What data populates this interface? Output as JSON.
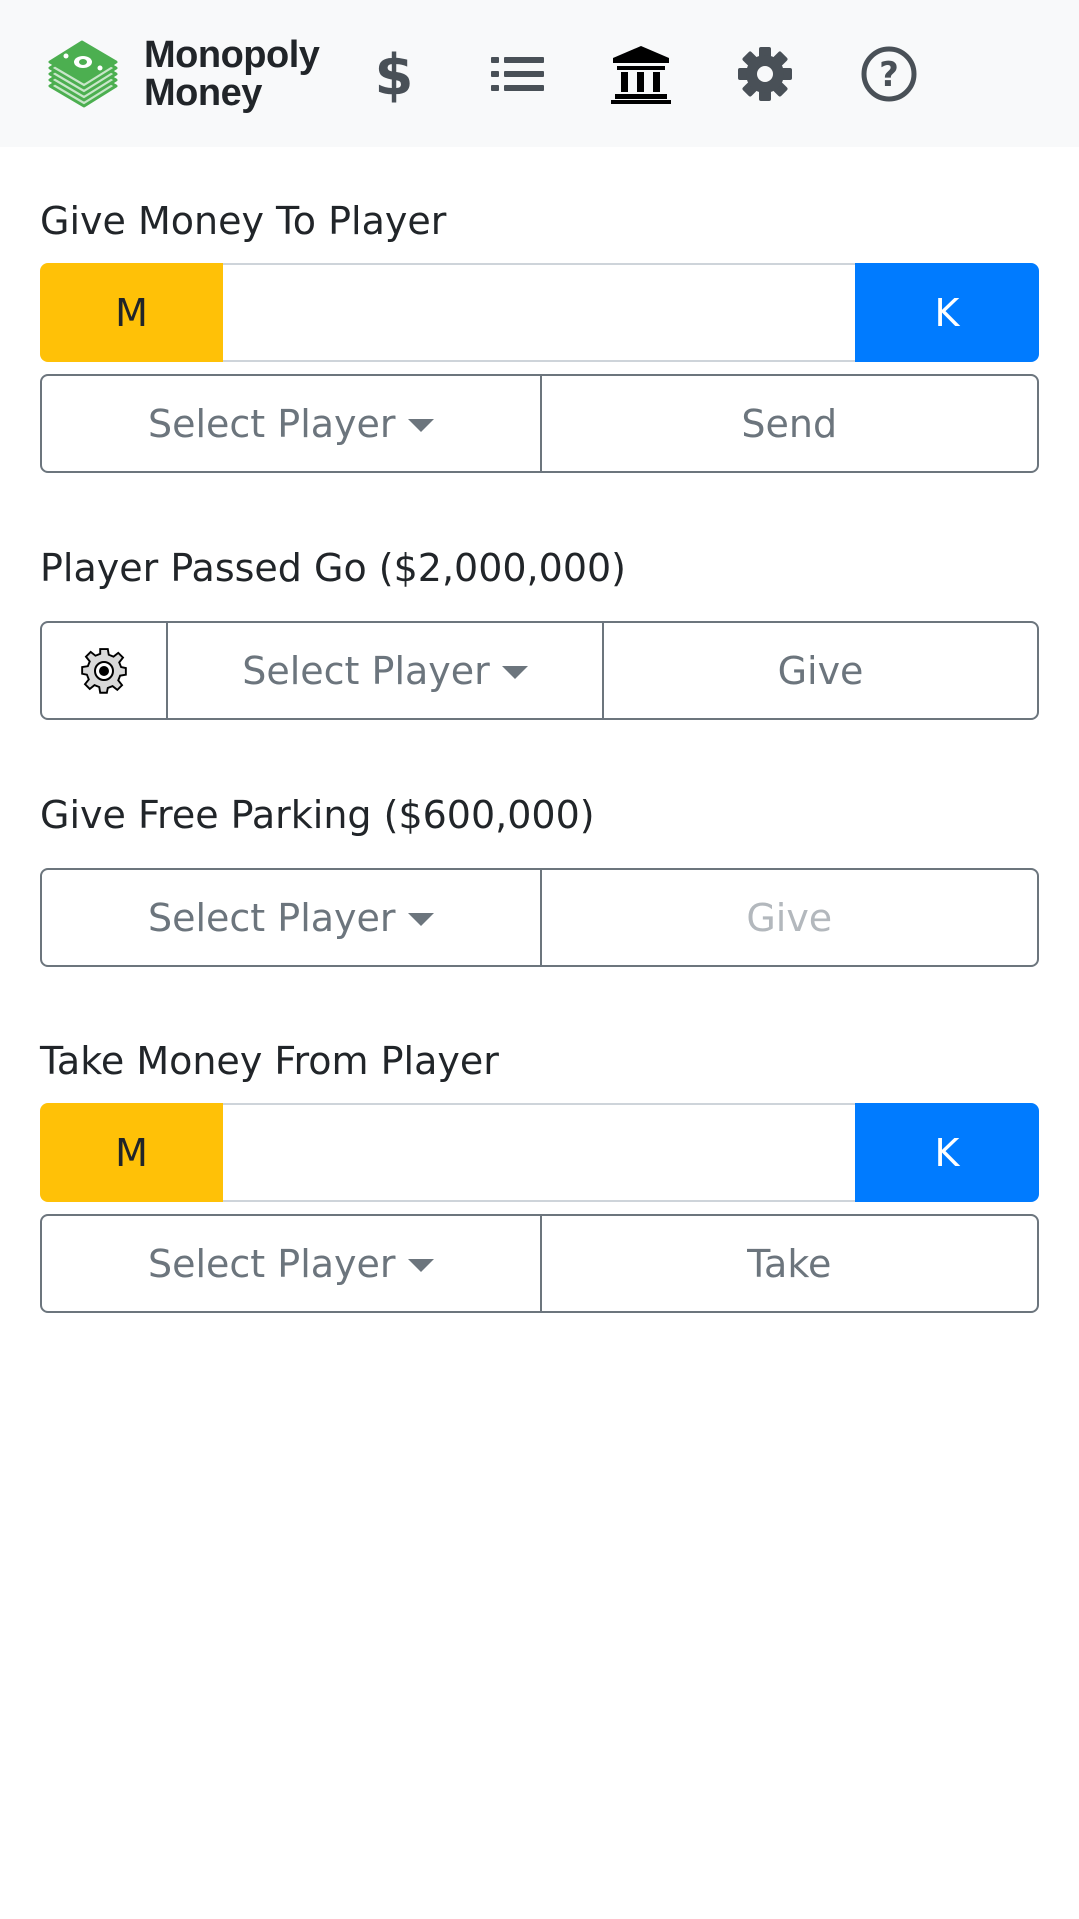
{
  "app": {
    "brand_line1": "Monopoly",
    "brand_line2": "Money"
  },
  "nav": {
    "items": [
      {
        "icon": "dollar-icon"
      },
      {
        "icon": "list-icon"
      },
      {
        "icon": "bank-icon",
        "active": true
      },
      {
        "icon": "gear-icon"
      },
      {
        "icon": "help-icon"
      }
    ]
  },
  "give_money": {
    "title": "Give Money To Player",
    "millions_label": "M",
    "thousands_label": "K",
    "amount_value": "",
    "select_label": "Select Player",
    "action_label": "Send"
  },
  "passed_go": {
    "title": "Player Passed Go ($2,000,000)",
    "select_label": "Select Player",
    "action_label": "Give"
  },
  "free_parking": {
    "title": "Give Free Parking ($600,000)",
    "select_label": "Select Player",
    "action_label": "Give"
  },
  "take_money": {
    "title": "Take Money From Player",
    "millions_label": "M",
    "thousands_label": "K",
    "amount_value": "",
    "select_label": "Select Player",
    "action_label": "Take"
  },
  "colors": {
    "millions_button": "#ffc107",
    "thousands_button": "#007bff",
    "outline": "#6c757d",
    "header_bg": "#f8f9fa",
    "logo_green": "#4caf50"
  }
}
